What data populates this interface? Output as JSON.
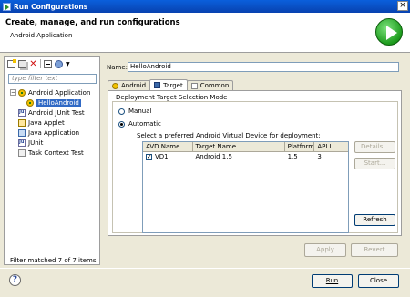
{
  "window": {
    "title": "Run Configurations"
  },
  "banner": {
    "title": "Create, manage, and run configurations",
    "subtitle": "Android Application"
  },
  "left": {
    "filter_placeholder": "type filter text",
    "tree": [
      {
        "label": "Android Application",
        "expanded": "−"
      },
      {
        "label": "HelloAndroid"
      },
      {
        "label": "Android JUnit Test"
      },
      {
        "label": "Java Applet"
      },
      {
        "label": "Java Application"
      },
      {
        "label": "JUnit"
      },
      {
        "label": "Task Context Test"
      }
    ],
    "status": "Filter matched 7 of 7 items"
  },
  "right": {
    "name_label": "Name:",
    "name_value": "HelloAndroid",
    "tabs": [
      {
        "label": "Android"
      },
      {
        "label": "Target"
      },
      {
        "label": "Common"
      }
    ],
    "target": {
      "mode_label": "Deployment Target Selection Mode",
      "manual_label": "Manual",
      "automatic_label": "Automatic",
      "select_label": "Select a preferred Android Virtual Device for deployment:",
      "columns": [
        "AVD Name",
        "Target Name",
        "Platform",
        "API L..."
      ],
      "rows": [
        {
          "avd": "VD1",
          "target": "Android 1.5",
          "platform": "1.5",
          "api": "3",
          "check": "✓"
        }
      ],
      "details_label": "Details...",
      "start_label": "Start...",
      "refresh_label": "Refresh"
    },
    "apply_label": "Apply",
    "revert_label": "Revert"
  },
  "footer": {
    "help_label": "?",
    "run_label": "Run",
    "close_label": "Close"
  }
}
